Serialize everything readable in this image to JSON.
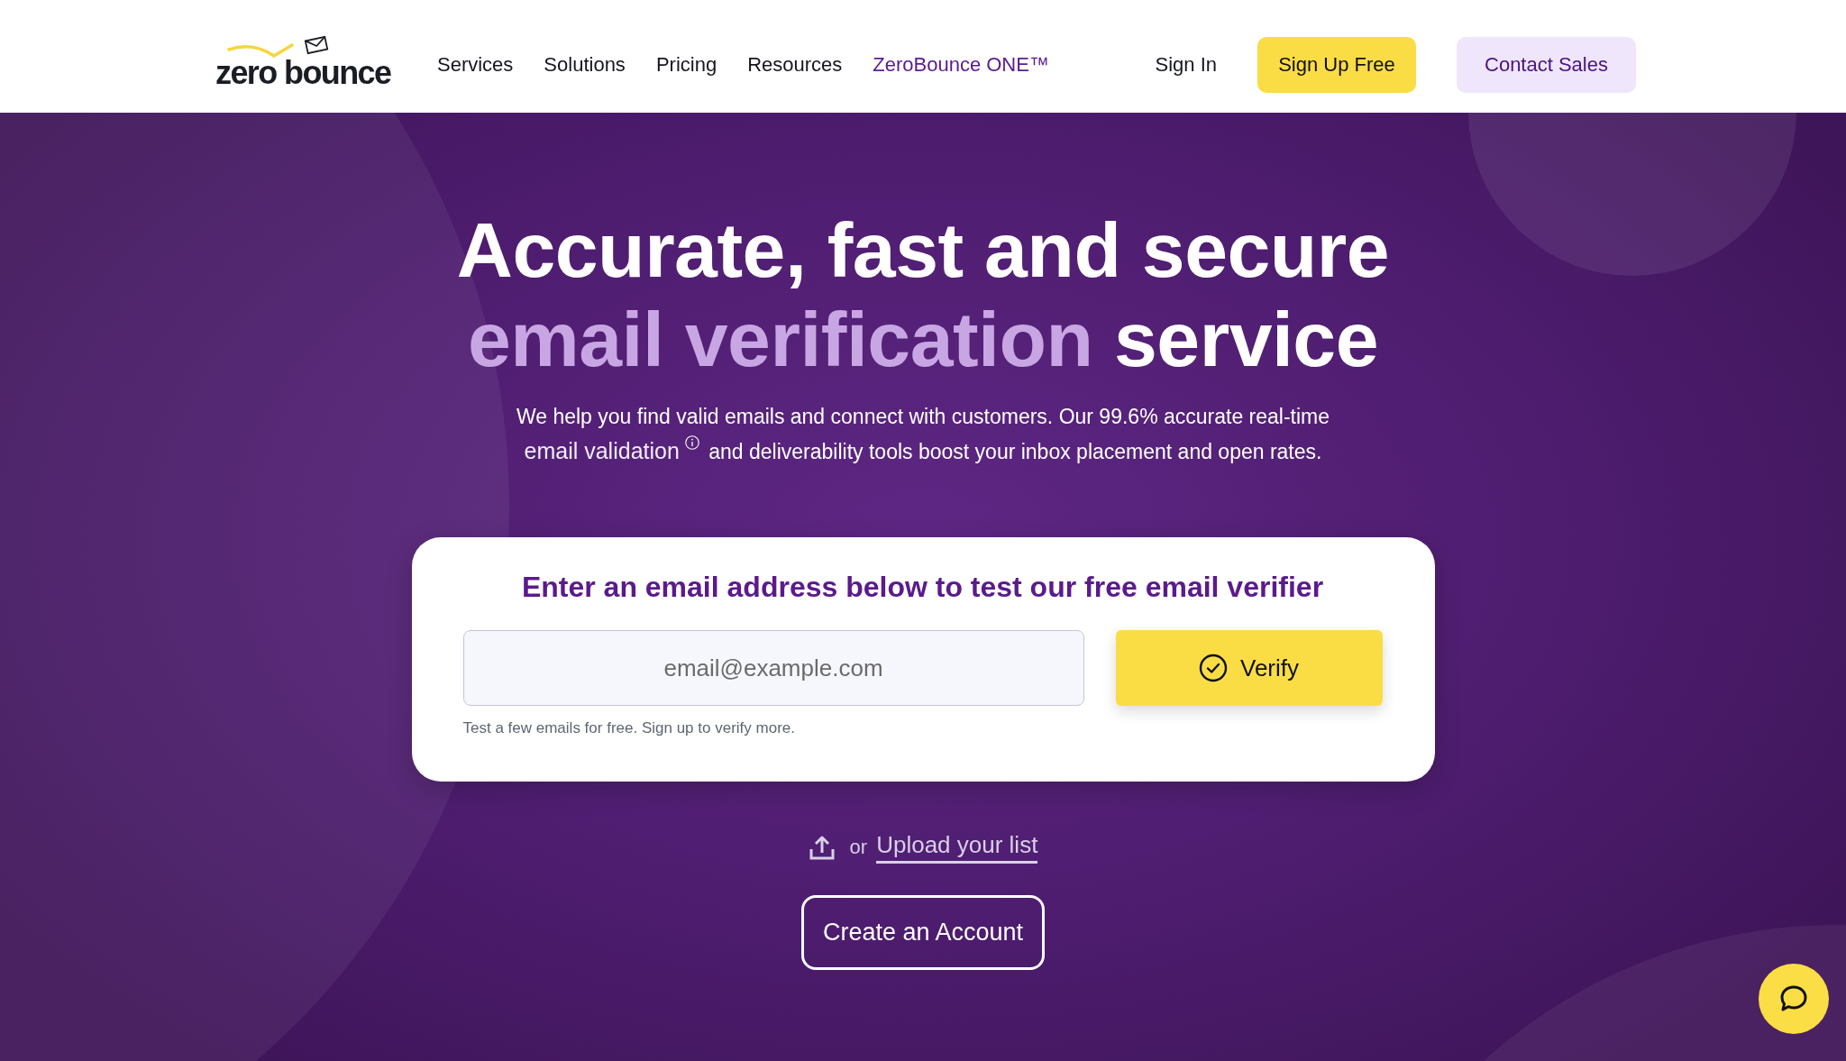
{
  "header": {
    "logo": {
      "text": "zero bounce"
    },
    "nav": [
      {
        "label": "Services",
        "highlighted": false
      },
      {
        "label": "Solutions",
        "highlighted": false
      },
      {
        "label": "Pricing",
        "highlighted": false
      },
      {
        "label": "Resources",
        "highlighted": false
      },
      {
        "label": "ZeroBounce ONE™",
        "highlighted": true
      }
    ],
    "actions": [
      {
        "label": "Sign In",
        "kind": "link"
      },
      {
        "label": "Sign Up Free",
        "kind": "primary"
      },
      {
        "label": "Contact Sales",
        "kind": "secondary"
      }
    ]
  },
  "hero": {
    "headline": [
      [
        {
          "text": "Accurate, fast and secure",
          "highlighted": false
        }
      ],
      [
        {
          "text": "email verification",
          "highlighted": true
        },
        {
          "text": "service",
          "highlighted": false
        }
      ]
    ],
    "intro": {
      "before": "We help you find valid emails and connect with customers. Our 99.6% accurate real-time",
      "link": "email validation",
      "after": "and deliverability tools boost your inbox placement and open rates."
    }
  },
  "verifier": {
    "title": "Enter an email address below to test our free email verifier",
    "email_field": {
      "placeholder": "email@example.com"
    },
    "button": "Verify",
    "hint": "Test a few emails for free. Sign up to verify more."
  },
  "upload": {
    "prefix": "or",
    "link": "Upload your list"
  },
  "create_account": "Create an Account"
}
